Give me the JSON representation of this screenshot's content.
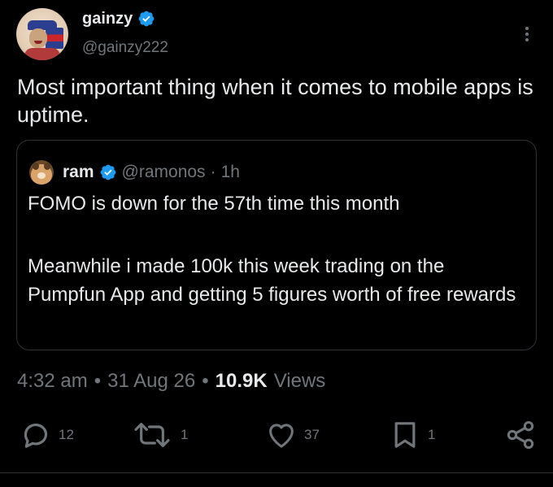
{
  "author": {
    "display_name": "gainzy",
    "handle": "@gainzy222"
  },
  "tweet": {
    "text": "Most important thing when it comes to mobile apps is uptime."
  },
  "quoted_tweet": {
    "display_name": "ram",
    "handle": "@ramonos",
    "dot": "·",
    "time": "1h",
    "line1": "FOMO is down for the 57th time this month",
    "line2": "Meanwhile i made 100k this week trading on the Pumpfun App and getting 5 figures worth of free rewards"
  },
  "meta": {
    "time": "4:32 am",
    "sep1": "•",
    "date": "31 Aug 26",
    "sep2": "•",
    "views_count": "10.9K",
    "views_label": "Views"
  },
  "actions": {
    "replies": "12",
    "reposts": "1",
    "likes": "37",
    "bookmarks": "1"
  },
  "icons": {
    "verified": "verified-badge-icon",
    "more": "more-vertical-icon",
    "reply": "reply-icon",
    "repost": "repost-icon",
    "like": "heart-icon",
    "bookmark": "bookmark-icon",
    "share": "share-icon"
  },
  "colors": {
    "background": "#000000",
    "text_primary": "#e7e9ea",
    "text_secondary": "#71767b",
    "verified": "#1d9bf0",
    "border": "#2f3336"
  }
}
